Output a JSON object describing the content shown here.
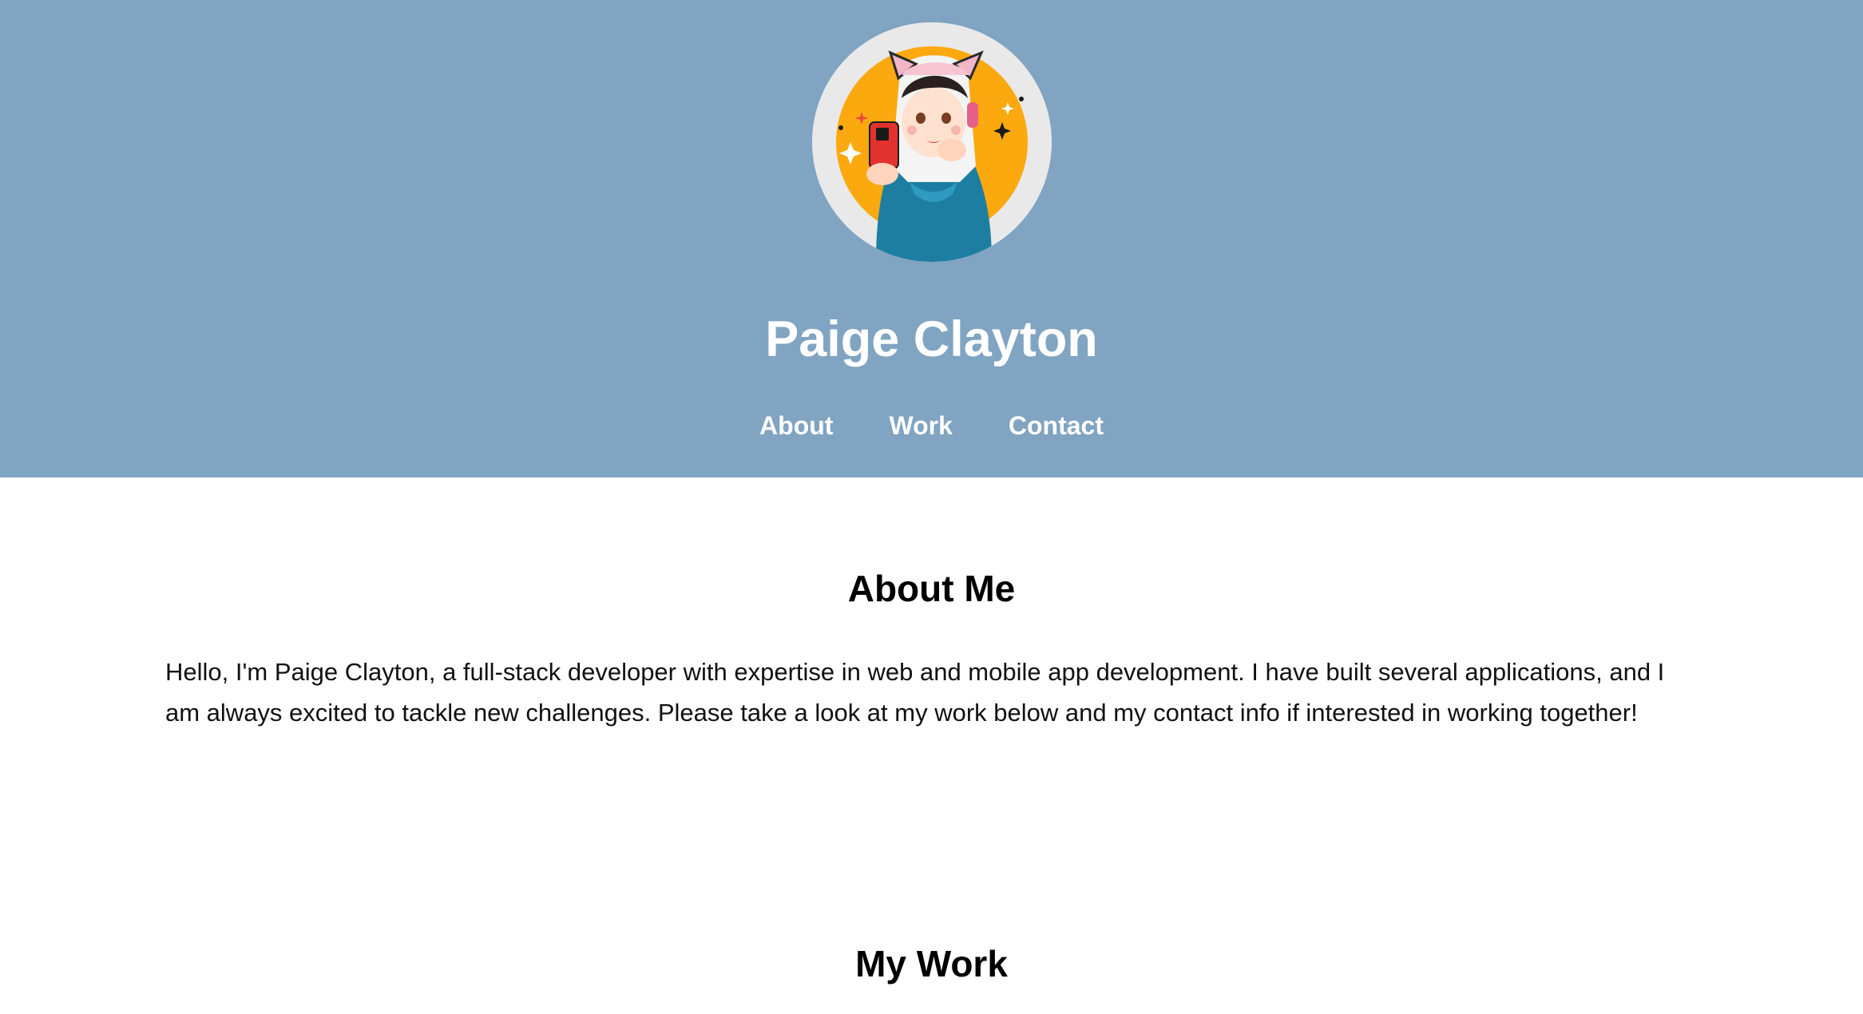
{
  "header": {
    "site_title": "Paige Clayton",
    "avatar_icon": "avatar-illustration-icon",
    "nav": [
      {
        "label": "About"
      },
      {
        "label": "Work"
      },
      {
        "label": "Contact"
      }
    ],
    "background_color": "#80a4c2"
  },
  "about": {
    "title": "About Me",
    "text": "Hello, I'm Paige Clayton, a full-stack developer with expertise in web and mobile app development. I have built several applications, and I am always excited to tackle new challenges. Please take a look at my work below and my contact info if interested in working together!"
  },
  "work": {
    "title": "My Work"
  }
}
